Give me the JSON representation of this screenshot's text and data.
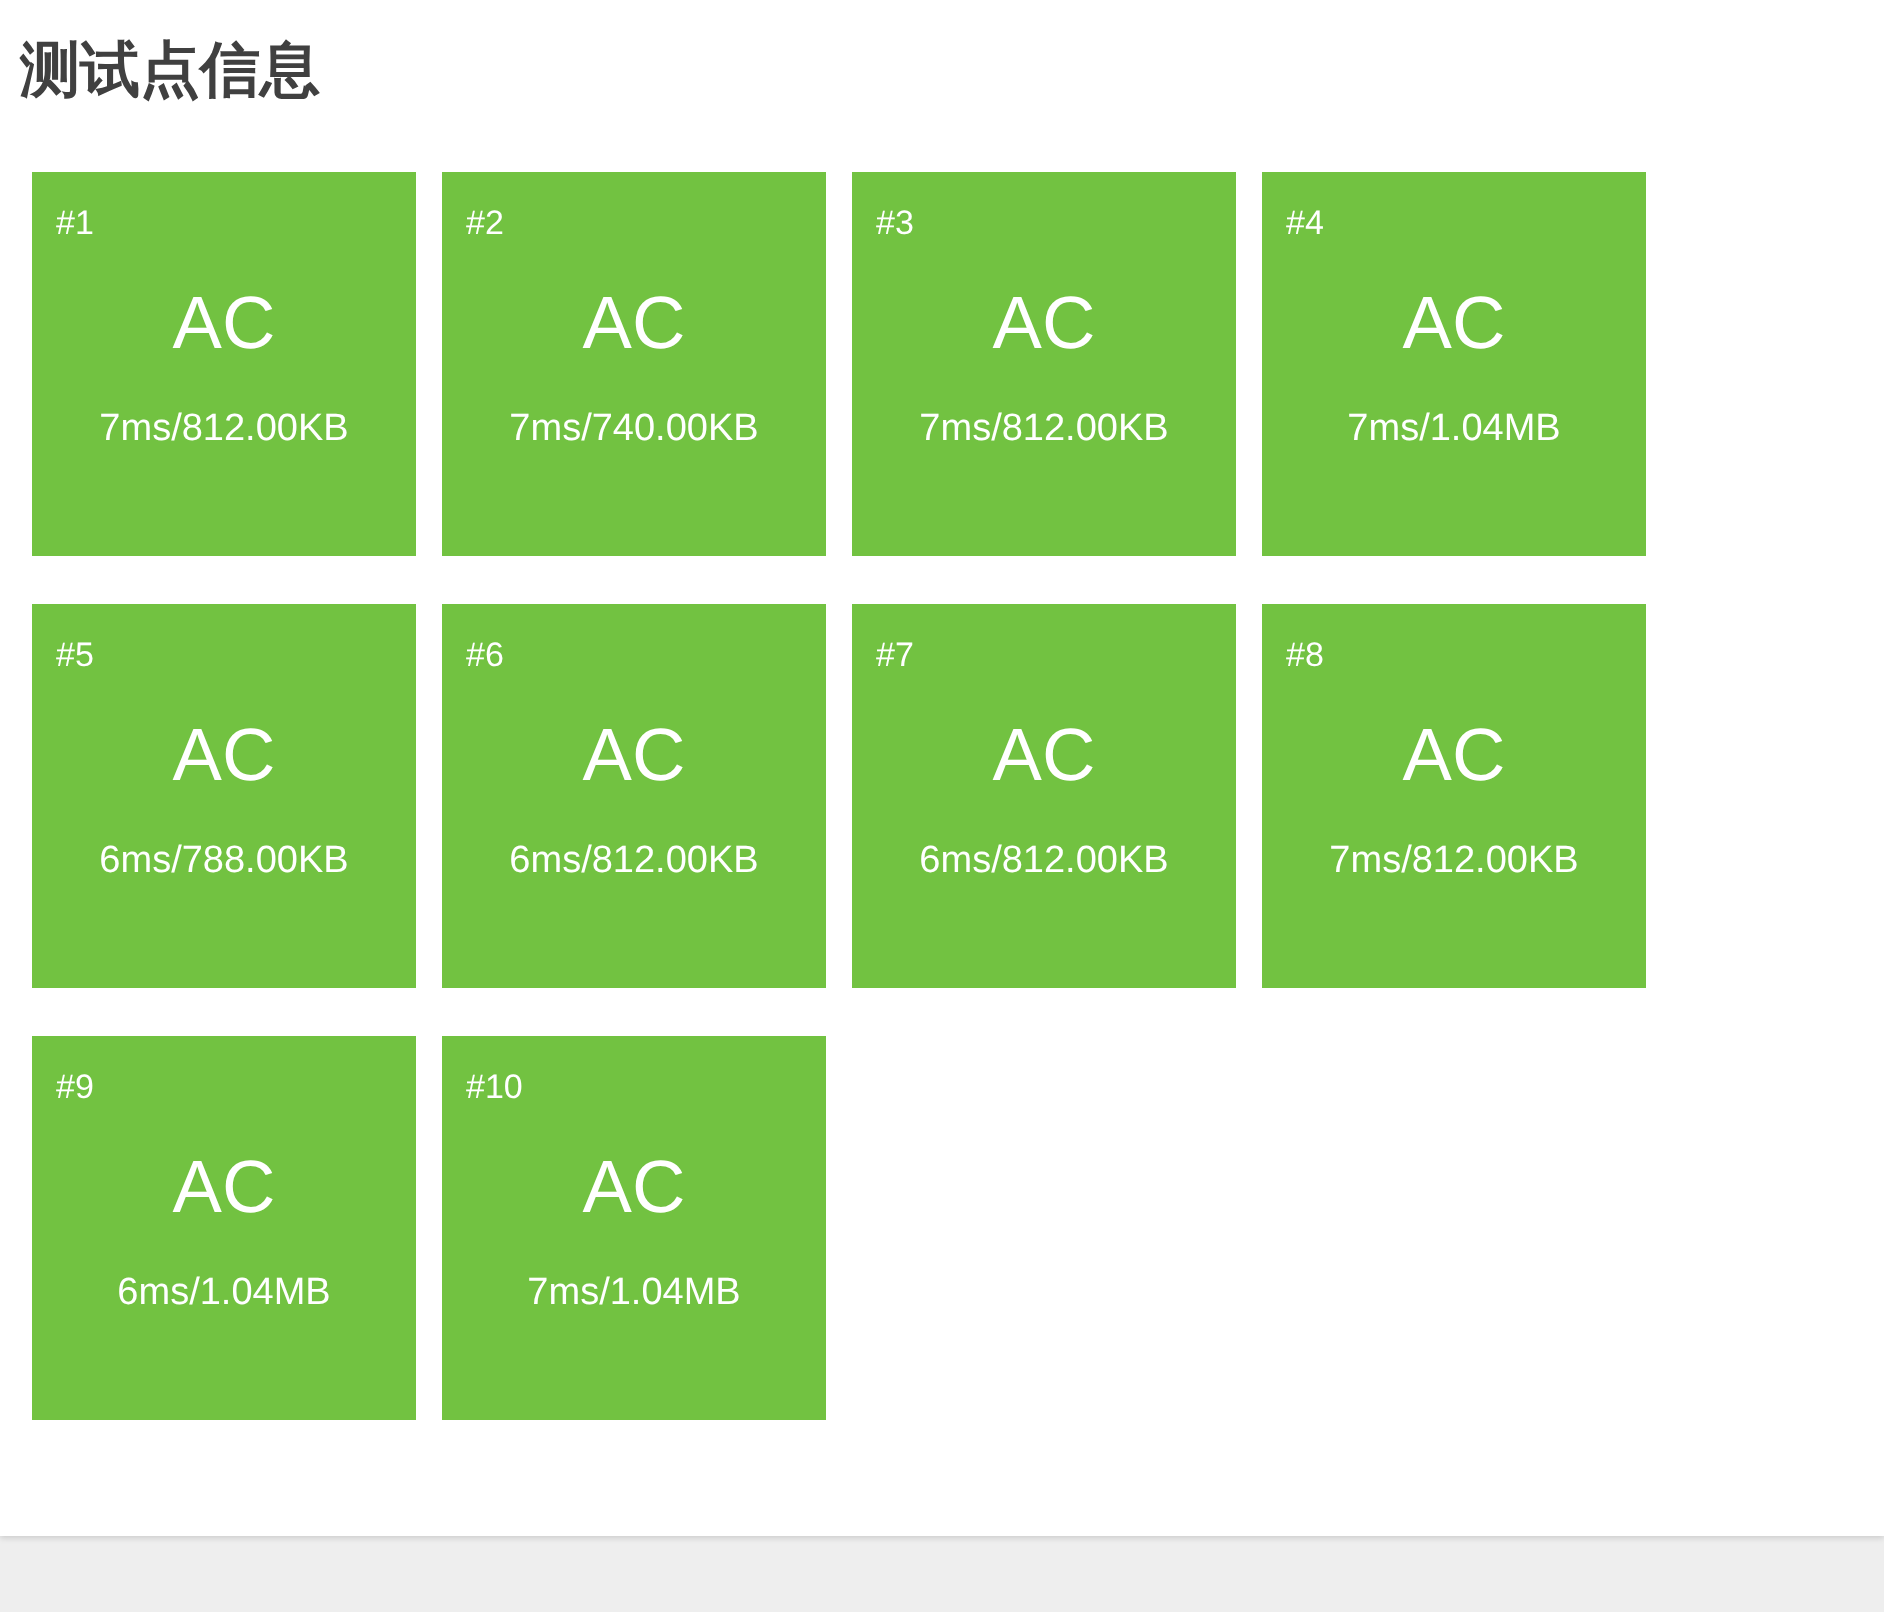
{
  "title": "测试点信息",
  "test_cases": [
    {
      "number": "#1",
      "verdict": "AC",
      "usage": "7ms/812.00KB",
      "color": "#72c241"
    },
    {
      "number": "#2",
      "verdict": "AC",
      "usage": "7ms/740.00KB",
      "color": "#72c241"
    },
    {
      "number": "#3",
      "verdict": "AC",
      "usage": "7ms/812.00KB",
      "color": "#72c241"
    },
    {
      "number": "#4",
      "verdict": "AC",
      "usage": "7ms/1.04MB",
      "color": "#72c241"
    },
    {
      "number": "#5",
      "verdict": "AC",
      "usage": "6ms/788.00KB",
      "color": "#72c241"
    },
    {
      "number": "#6",
      "verdict": "AC",
      "usage": "6ms/812.00KB",
      "color": "#72c241"
    },
    {
      "number": "#7",
      "verdict": "AC",
      "usage": "6ms/812.00KB",
      "color": "#72c241"
    },
    {
      "number": "#8",
      "verdict": "AC",
      "usage": "7ms/812.00KB",
      "color": "#72c241"
    },
    {
      "number": "#9",
      "verdict": "AC",
      "usage": "6ms/1.04MB",
      "color": "#72c241"
    },
    {
      "number": "#10",
      "verdict": "AC",
      "usage": "7ms/1.04MB",
      "color": "#72c241"
    }
  ]
}
